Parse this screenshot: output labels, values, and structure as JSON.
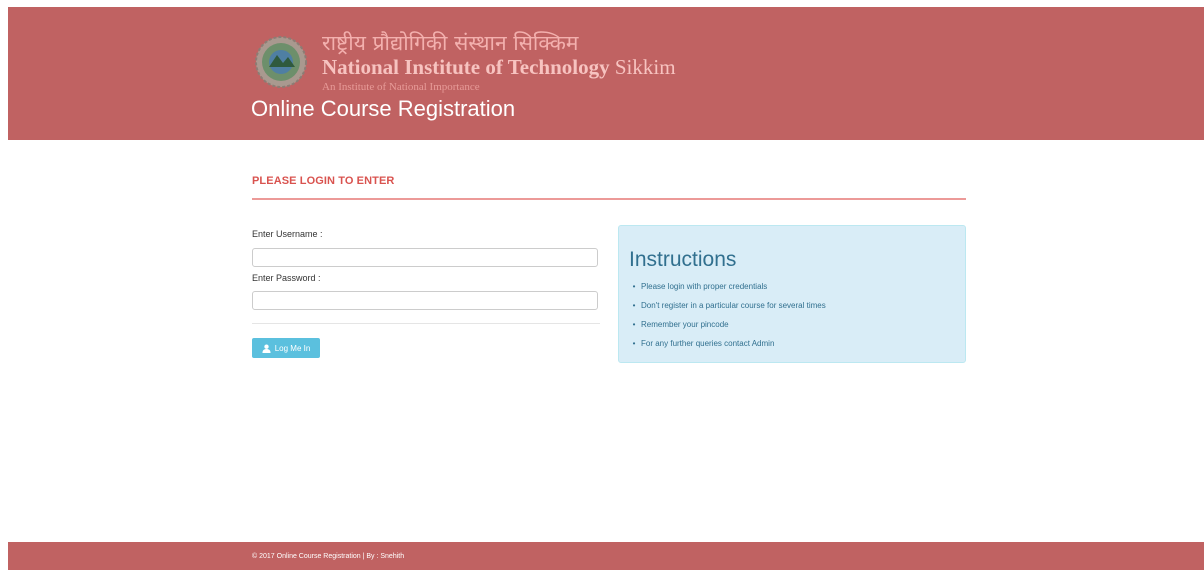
{
  "header": {
    "institute_hindi": "राष्ट्रीय प्रौद्योगिकी संस्थान सिक्किम",
    "institute_english_main": "National Institute of Technology",
    "institute_english_suffix": "Sikkim",
    "institute_tagline": "An Institute of National Importance",
    "app_title": "Online Course Registration",
    "background_color": "#c06262"
  },
  "login": {
    "heading": "PLEASE LOGIN TO ENTER",
    "username_label": "Enter Username :",
    "username_value": "",
    "password_label": "Enter Password :",
    "password_value": "",
    "button_label": "Log Me In",
    "button_icon": "user-icon",
    "accent_color": "#d9534f",
    "button_color": "#5bc0de"
  },
  "instructions": {
    "title": "Instructions",
    "items": [
      "Please login with proper credentials",
      "Don't register in a particular course for several times",
      "Remember your pincode",
      "For any further queries contact Admin"
    ],
    "background_color": "#d9edf7",
    "text_color": "#31708f"
  },
  "footer": {
    "text": "© 2017 Online Course Registration | By : Snehith"
  }
}
